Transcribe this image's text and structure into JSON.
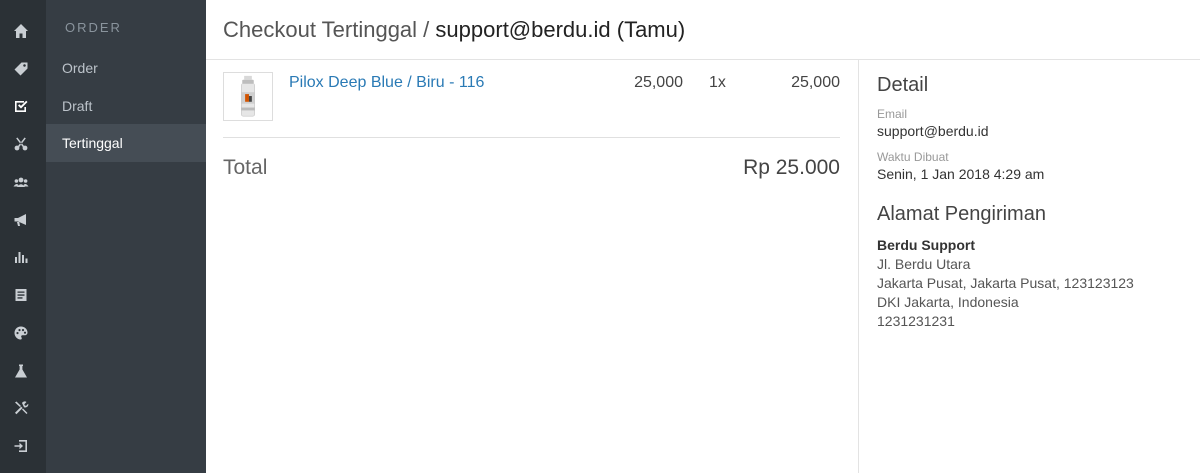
{
  "iconbar": {
    "items": [
      {
        "icon": "home-icon"
      },
      {
        "icon": "tag-icon"
      },
      {
        "icon": "checkbox-icon"
      },
      {
        "icon": "scissors-icon"
      },
      {
        "icon": "users-icon"
      },
      {
        "icon": "megaphone-icon"
      },
      {
        "icon": "bar-chart-icon"
      },
      {
        "icon": "document-icon"
      },
      {
        "icon": "palette-icon"
      },
      {
        "icon": "flask-icon"
      },
      {
        "icon": "tools-icon"
      },
      {
        "icon": "logout-icon"
      }
    ]
  },
  "subnav": {
    "heading": "ORDER",
    "items": [
      {
        "label": "Order"
      },
      {
        "label": "Draft"
      },
      {
        "label": "Tertinggal"
      }
    ]
  },
  "header": {
    "section": "Checkout Tertinggal",
    "separator": "/",
    "customer": "support@berdu.id (Tamu)"
  },
  "items": [
    {
      "name": "Pilox Deep Blue / Biru - 116",
      "price": "25,000",
      "qty": "1x",
      "subtotal": "25,000"
    }
  ],
  "summary": {
    "total_label": "Total",
    "total_value": "Rp 25.000"
  },
  "detail": {
    "title": "Detail",
    "email_label": "Email",
    "email": "support@berdu.id",
    "created_label": "Waktu Dibuat",
    "created": "Senin, 1 Jan 2018 4:29 am"
  },
  "shipping": {
    "title": "Alamat Pengiriman",
    "name": "Berdu Support",
    "street": "Jl. Berdu Utara",
    "city": "Jakarta Pusat, Jakarta Pusat, 123123123",
    "region": "DKI Jakarta, Indonesia",
    "phone": "1231231231"
  },
  "colors": {
    "iconbar_bg": "#2b3136",
    "subnav_bg": "#363d44",
    "subnav_active": "#454d55",
    "link": "#2a7ab5"
  }
}
